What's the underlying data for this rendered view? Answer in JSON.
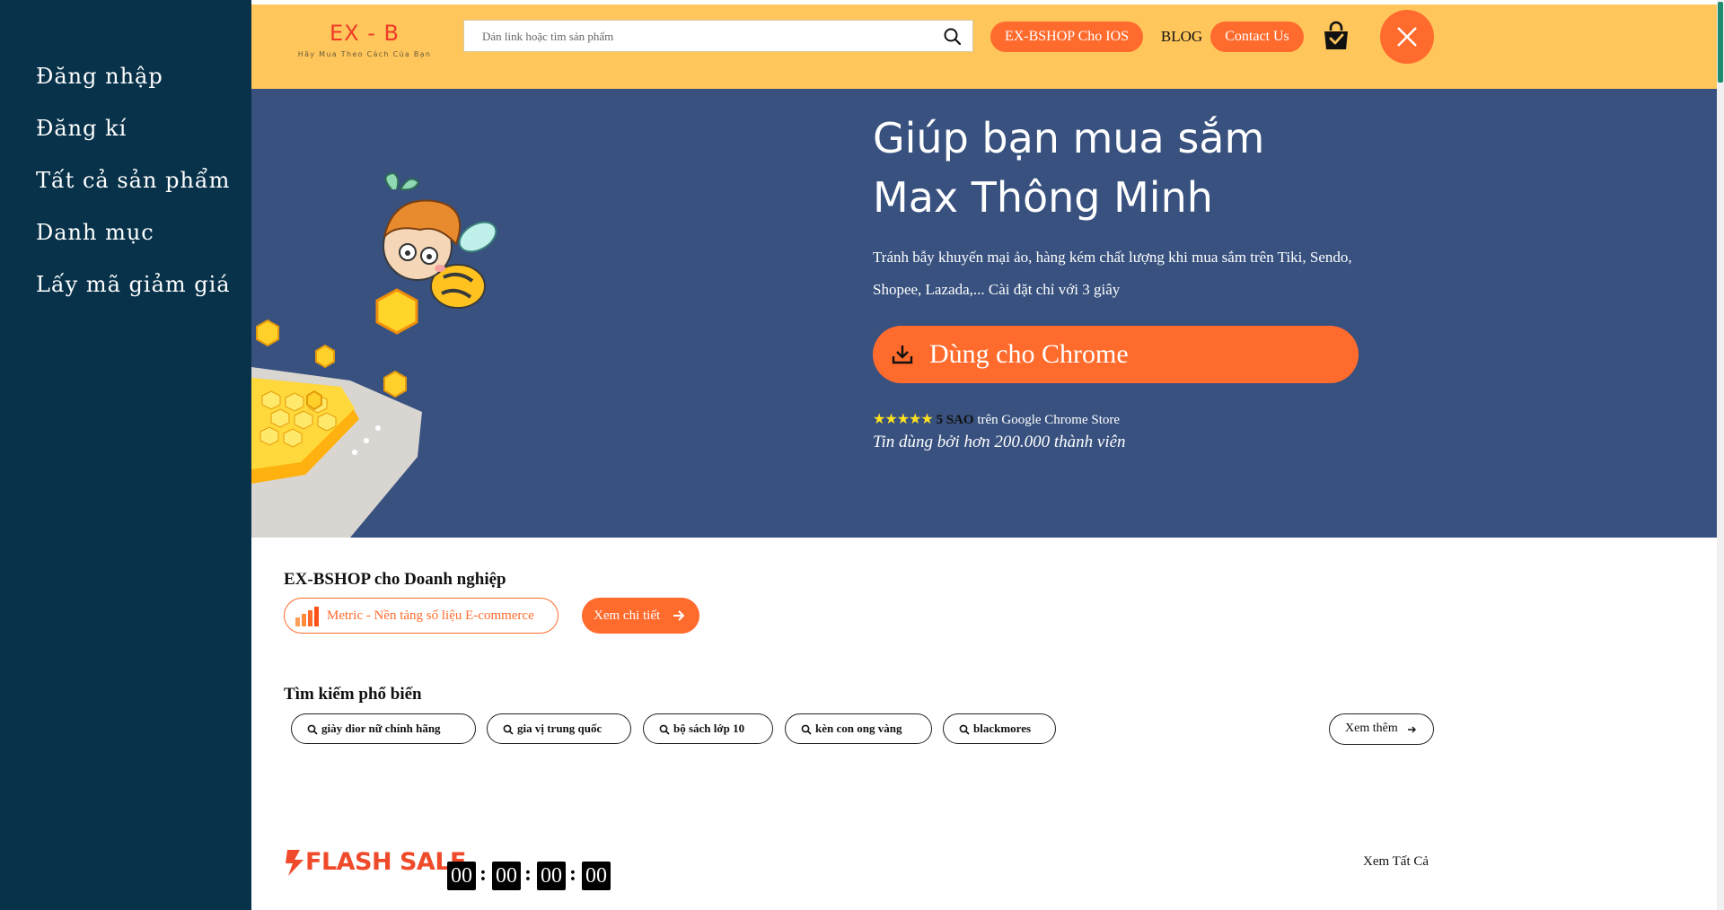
{
  "sidebar": {
    "items": [
      {
        "label": "Đăng nhập"
      },
      {
        "label": "Đăng kí"
      },
      {
        "label": "Tất cả sản phẩm"
      },
      {
        "label": "Danh mục"
      },
      {
        "label": "Lấy mã giảm giá"
      }
    ]
  },
  "header": {
    "logo_title": "EX - B",
    "logo_subtitle": "Hãy Mua Theo Cách Của Bạn",
    "search_placeholder": "Dán link hoặc tìm sản phẩm",
    "ios_button": "EX-BSHOP Cho IOS",
    "blog_link": "BLOG",
    "contact_button": "Contact Us"
  },
  "hero": {
    "title": "Giúp bạn mua sắm Max Thông Minh",
    "description": "Tránh bẫy khuyến mại ảo, hàng kém chất lượng khi mua sắm trên Tiki, Sendo, Shopee, Lazada,... Cài đặt chỉ với 3 giây",
    "cta": "Dùng cho Chrome",
    "stars": "★★★★★",
    "rating_strong": "5 SAO",
    "rating_rest": " trên Google Chrome Store",
    "trust": "Tin dùng bởi hơn 200.000 thành viên"
  },
  "business": {
    "title": "EX-BSHOP cho Doanh nghiệp",
    "metric_label": "Metric - Nền tảng số liệu E-commerce",
    "detail_button": "Xem chi tiết"
  },
  "popular": {
    "title": "Tìm kiếm phổ biến",
    "chips": [
      {
        "label": "giày dior nữ chính hãng"
      },
      {
        "label": "gia vị trung quốc"
      },
      {
        "label": "bộ sách lớp 10"
      },
      {
        "label": "kèn con ong vàng"
      },
      {
        "label": "blackmores"
      }
    ],
    "more_button": "Xem thêm"
  },
  "flash_sale": {
    "label": "FLASH SALE",
    "timer": [
      "00",
      "00",
      "00",
      "00"
    ],
    "see_all": "Xem Tất Cả"
  },
  "colors": {
    "sidebar_bg": "#08324a",
    "topbar_bg": "#fec65b",
    "hero_bg": "#38517f",
    "accent": "#ff6b2d",
    "logo_red": "#ef3b27",
    "star_yellow": "#ffe11f"
  }
}
